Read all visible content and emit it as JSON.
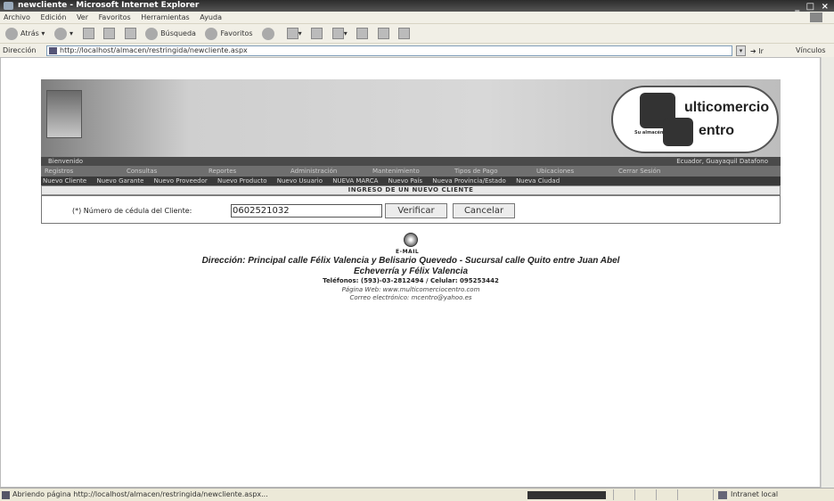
{
  "window": {
    "title": "newcliente - Microsoft Internet Explorer",
    "controls": "_ □ ×"
  },
  "menu": [
    "Archivo",
    "Edición",
    "Ver",
    "Favoritos",
    "Herramientas",
    "Ayuda"
  ],
  "toolbar": {
    "back": "Atrás",
    "search": "Búsqueda",
    "favorites": "Favoritos"
  },
  "address": {
    "label": "Dirección",
    "url": "http://localhost/almacen/restringida/newcliente.aspx",
    "go": "Ir",
    "links": "Vínculos"
  },
  "logo": {
    "line1": "ulticomercio",
    "line2": "entro",
    "tagline": "Su almacén"
  },
  "header": {
    "welcome": "Bienvenido",
    "location": "Ecuador, Guayaquil Datafono"
  },
  "menu_row2": [
    "Registros",
    "Consultas",
    "Reportes",
    "Administración",
    "Mantenimiento",
    "Tipos de Pago",
    "Ubicaciones",
    "Cerrar Sesión"
  ],
  "nav_links": [
    "Nuevo Cliente",
    "Nuevo Garante",
    "Nuevo Proveedor",
    "Nuevo Producto",
    "Nuevo Usuario",
    "NUEVA MARCA",
    "Nuevo País",
    "Nueva Provincia/Estado",
    "Nueva Ciudad"
  ],
  "section_title": "INGRESO DE UN NUEVO CLIENTE",
  "form": {
    "label": "(*) Número de cédula del Cliente:",
    "cedula_value": "0602521032",
    "verify": "Verificar",
    "cancel": "Cancelar"
  },
  "footer": {
    "email_label": "E-MAIL",
    "address_line1": "Dirección: Principal calle Félix Valencia y Belisario Quevedo - Sucursal calle Quito entre Juan Abel",
    "address_line2": "Echeverría y Félix Valencia",
    "phones": "Teléfonos: (593)-03-2812494 / Celular: 095253442",
    "web": "Página Web: www.multicomerciocentro.com",
    "mail": "Correo electrónico: mcentro@yahoo.es"
  },
  "status": {
    "message": "Abriendo página http://localhost/almacen/restringida/newcliente.aspx...",
    "zone": "Intranet local"
  }
}
